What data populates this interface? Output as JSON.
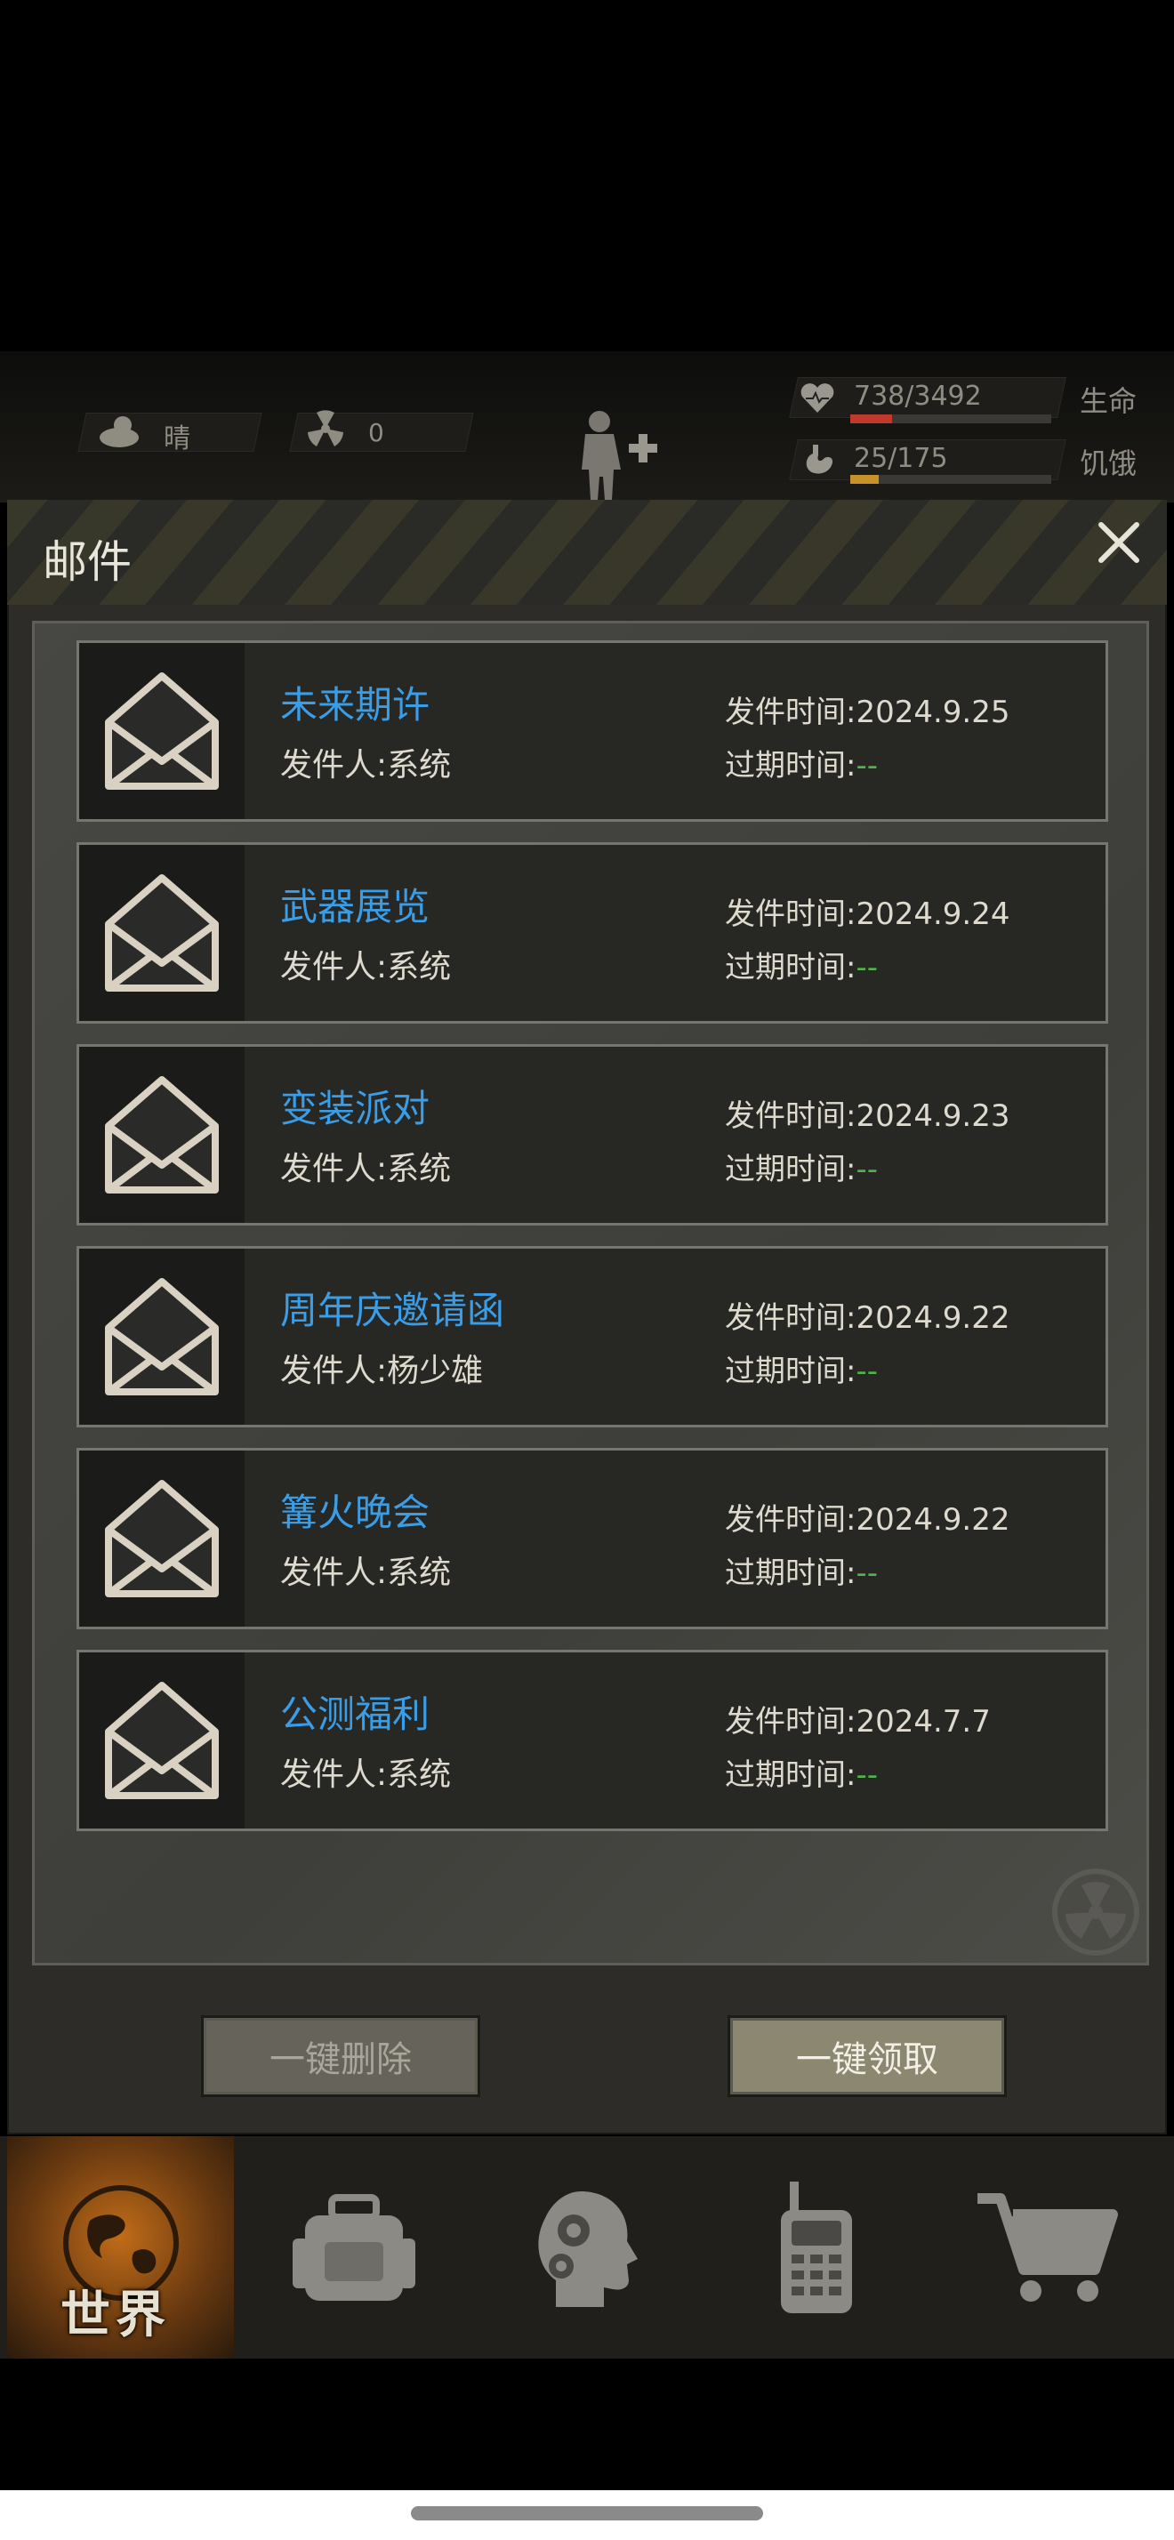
{
  "status": {
    "weather_text": "晴",
    "radiation_value": "0",
    "health": {
      "value": "738/3492",
      "label": "生命",
      "fraction": 0.21,
      "color": "#c0392b"
    },
    "hunger": {
      "value": "25/175",
      "label": "饥饿",
      "fraction": 0.14,
      "color": "#c8922a"
    }
  },
  "mail_panel": {
    "title": "邮件",
    "send_time_label": "发件时间:",
    "expire_label": "过期时间:",
    "sender_label": "发件人:",
    "expire_value": "--",
    "items": [
      {
        "subject": "未来期许",
        "sender": "系统",
        "send_date": "2024.9.25"
      },
      {
        "subject": "武器展览",
        "sender": "系统",
        "send_date": "2024.9.24"
      },
      {
        "subject": "变装派对",
        "sender": "系统",
        "send_date": "2024.9.23"
      },
      {
        "subject": "周年庆邀请函",
        "sender": "杨少雄",
        "send_date": "2024.9.22"
      },
      {
        "subject": "篝火晚会",
        "sender": "系统",
        "send_date": "2024.9.22"
      },
      {
        "subject": "公测福利",
        "sender": "系统",
        "send_date": "2024.7.7"
      }
    ],
    "delete_all_label": "一键删除",
    "claim_all_label": "一键领取"
  },
  "nav": {
    "world_label": "世界",
    "items": [
      "world-icon",
      "backpack-icon",
      "skills-head-icon",
      "radio-icon",
      "shop-cart-icon"
    ]
  }
}
